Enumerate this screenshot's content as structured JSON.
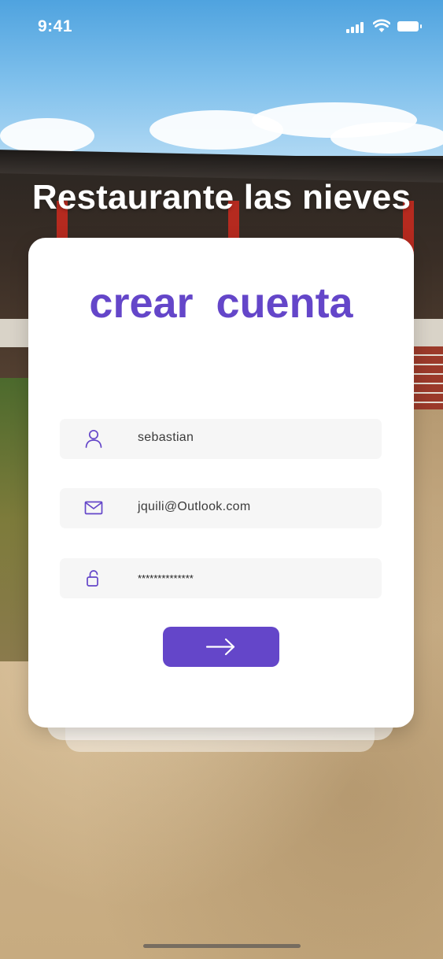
{
  "status_bar": {
    "time": "9:41"
  },
  "header": {
    "title": "Restaurante las nieves"
  },
  "form": {
    "title": "crear  cuenta",
    "fields": [
      {
        "icon": "user-icon",
        "value": "sebastian"
      },
      {
        "icon": "mail-icon",
        "value": "jquili@Outlook.com"
      },
      {
        "icon": "lock-icon",
        "value": "**************"
      }
    ],
    "submit_icon": "arrow-right-icon"
  },
  "colors": {
    "accent": "#6446c9",
    "card": "#ffffff",
    "field_bg": "#f6f6f6"
  }
}
